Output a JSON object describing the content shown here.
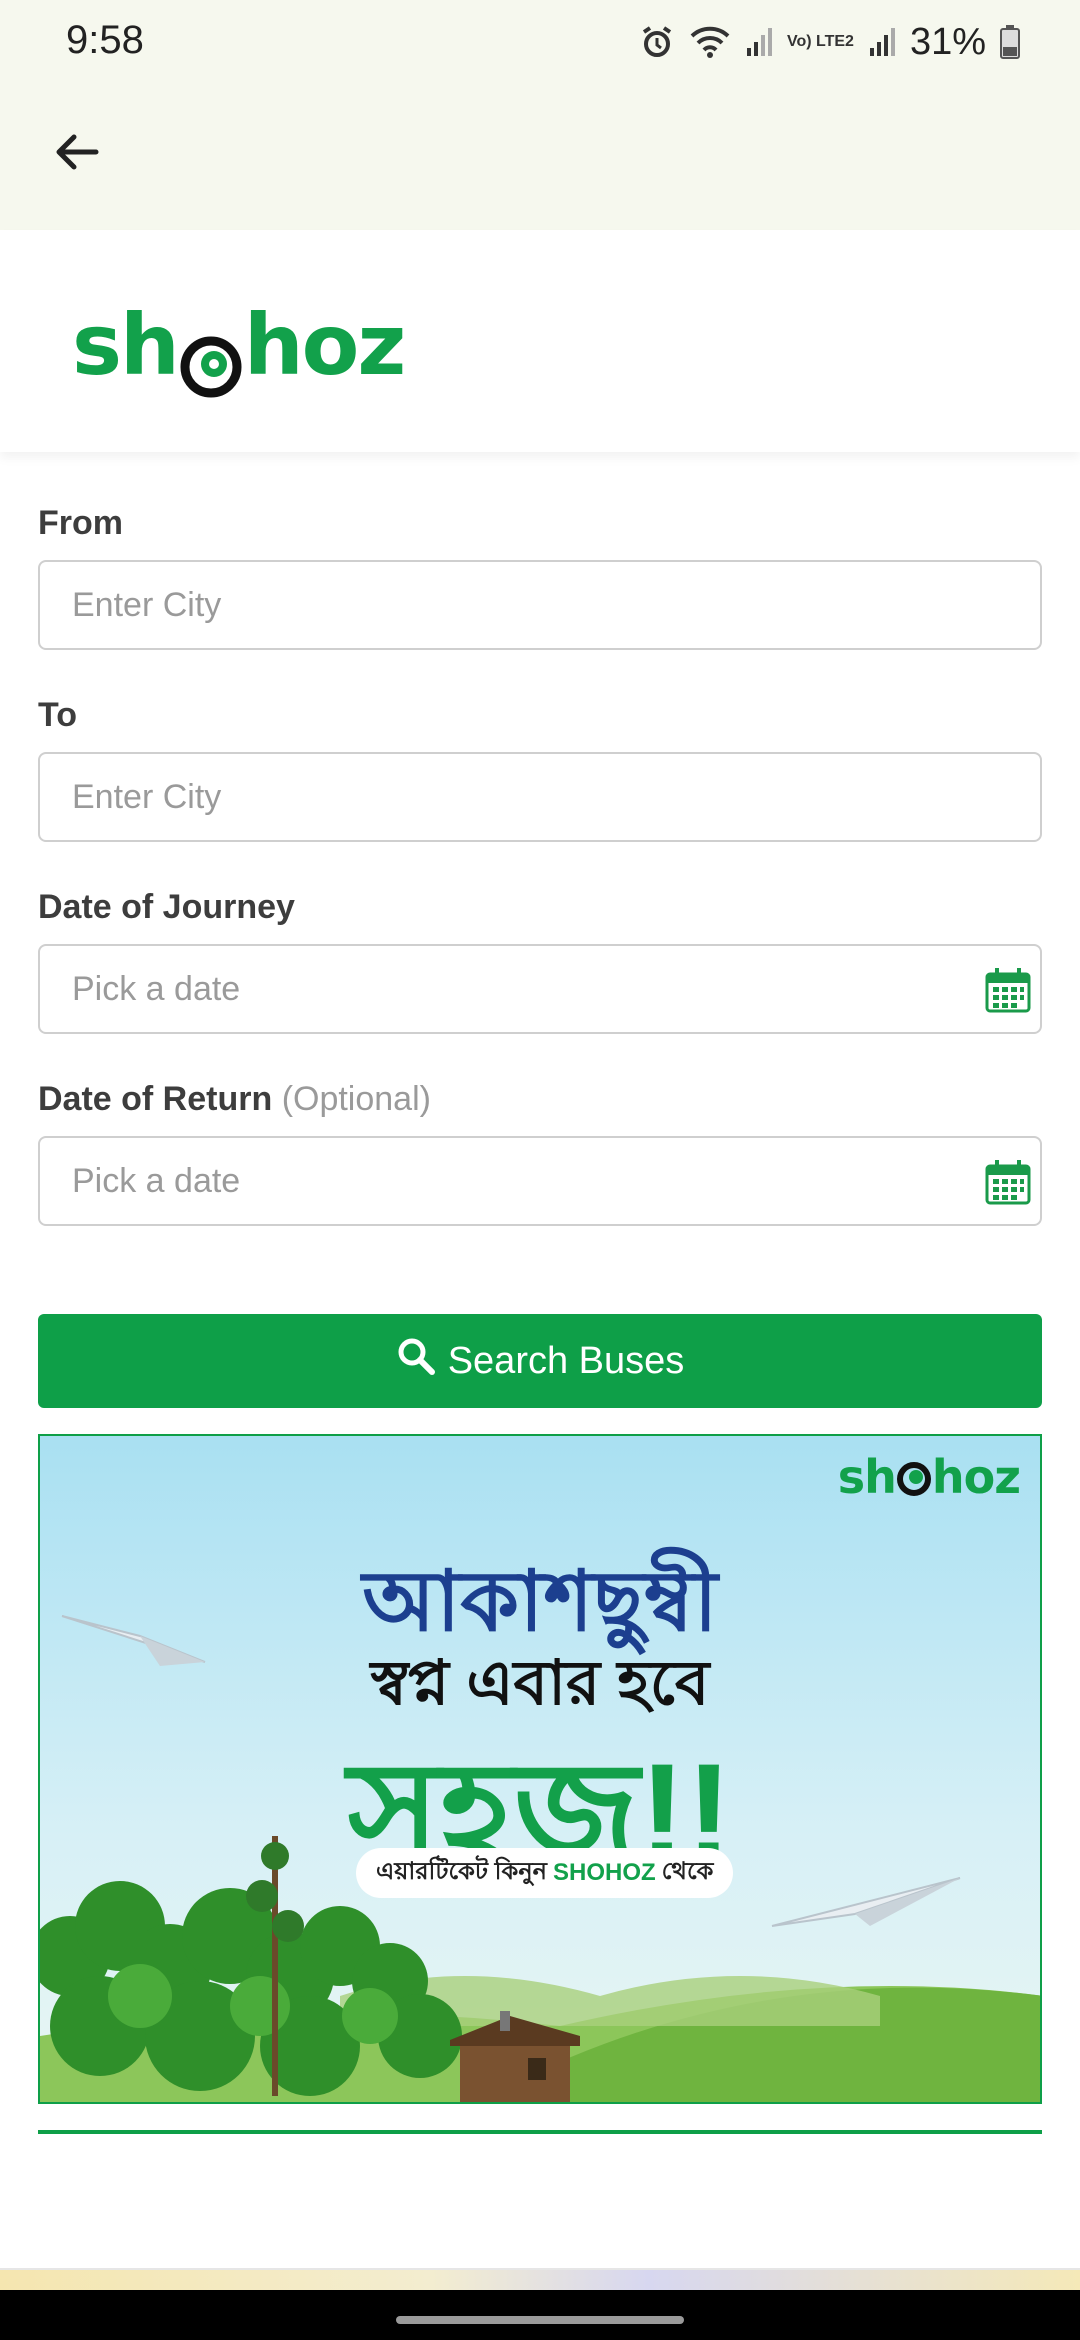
{
  "status_bar": {
    "time": "9:58",
    "battery": "31%",
    "network_label": "Vo) LTE2",
    "icons": [
      "alarm-icon",
      "wifi-icon",
      "signal-icon",
      "battery-icon"
    ]
  },
  "app_bar": {
    "back_icon": "arrow-left-icon"
  },
  "logo": {
    "brand": "shohoz",
    "text_left": "sh",
    "text_right": "hoz",
    "color": "#12a14b"
  },
  "form": {
    "from": {
      "label": "From",
      "placeholder": "Enter City"
    },
    "to": {
      "label": "To",
      "placeholder": "Enter City"
    },
    "date_of_journey": {
      "label": "Date of Journey",
      "placeholder": "Pick a date",
      "icon": "calendar-icon"
    },
    "date_of_return": {
      "label": "Date of Return",
      "optional_label": "(Optional)",
      "placeholder": "Pick a date",
      "icon": "calendar-icon"
    },
    "search_button": {
      "label": "Search Buses",
      "icon": "search-icon",
      "color": "#0e9f48"
    }
  },
  "banner": {
    "logo_left": "sh",
    "logo_right": "hoz",
    "line1": "আকাশছুম্বী",
    "line2": "স্বপ্ন এবার হবে",
    "line3": "সহজ!!",
    "pill_prefix": "এয়ারটিকেট কিনুন",
    "pill_brand": "SHOHOZ",
    "pill_suffix": "থেকে"
  },
  "colors": {
    "accent": "#0e9f48",
    "header_bg": "#f6f8ee",
    "input_border": "#cfcfcf",
    "placeholder": "#9a9a9a"
  }
}
